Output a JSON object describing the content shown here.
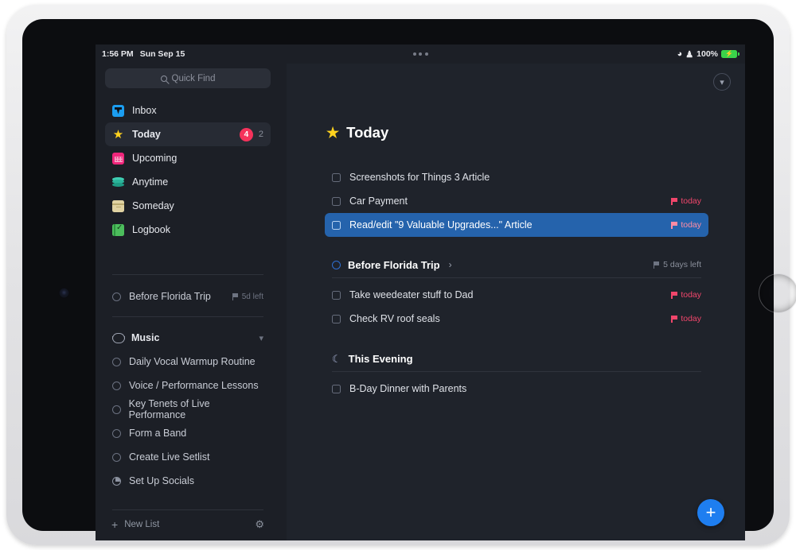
{
  "status_bar": {
    "time": "1:56 PM",
    "date": "Sun Sep 15",
    "battery_percent": "100%",
    "wifi_icon": "wifi-icon",
    "headphones_icon": "headphones-icon",
    "battery_icon": "battery-charging-icon",
    "menu_icon": "more-options-icon"
  },
  "sidebar": {
    "search": {
      "placeholder": "Quick Find",
      "icon": "search-icon"
    },
    "nav": [
      {
        "label": "Inbox",
        "icon": "inbox-icon",
        "badge": "",
        "count": "",
        "active": false
      },
      {
        "label": "Today",
        "icon": "star-icon",
        "badge": "4",
        "count": "2",
        "active": true
      },
      {
        "label": "Upcoming",
        "icon": "calendar-icon",
        "badge": "",
        "count": "",
        "active": false
      },
      {
        "label": "Anytime",
        "icon": "layers-icon",
        "badge": "",
        "count": "",
        "active": false
      },
      {
        "label": "Someday",
        "icon": "box-icon",
        "badge": "",
        "count": "",
        "active": false
      },
      {
        "label": "Logbook",
        "icon": "logbook-icon",
        "badge": "",
        "count": "",
        "active": false
      }
    ],
    "project": {
      "label": "Before Florida Trip",
      "meta": "5d left",
      "icon": "project-circle-icon",
      "meta_icon": "flag-icon"
    },
    "area": {
      "label": "Music",
      "icon": "area-icon",
      "chevron": "chevron-down-icon"
    },
    "area_projects": [
      {
        "label": "Daily Vocal Warmup Routine",
        "icon": "project-circle-icon"
      },
      {
        "label": "Voice / Performance Lessons",
        "icon": "project-circle-icon"
      },
      {
        "label": "Key Tenets of Live Performance",
        "icon": "project-circle-icon"
      },
      {
        "label": "Form a Band",
        "icon": "project-circle-icon"
      },
      {
        "label": "Create Live Setlist",
        "icon": "project-circle-icon"
      },
      {
        "label": "Set Up Socials",
        "icon": "project-progress-icon"
      }
    ],
    "footer": {
      "new_list_label": "New List",
      "plus_icon": "plus-icon",
      "settings_icon": "gear-icon"
    }
  },
  "main": {
    "collapse_icon": "chevron-down-circle-icon",
    "title": "Today",
    "title_icon": "star-icon",
    "todos": [
      {
        "text": "Screenshots for Things 3 Article",
        "when": "",
        "selected": false
      },
      {
        "text": "Car Payment",
        "when": "today",
        "selected": false
      },
      {
        "text": "Read/edit \"9 Valuable Upgrades...\" Article",
        "when": "today",
        "selected": true
      }
    ],
    "groups": [
      {
        "title": "Before Florida Trip",
        "icon": "project-circle-icon",
        "chevron": "chevron-right-icon",
        "meta": "5 days left",
        "meta_icon": "flag-icon",
        "items": [
          {
            "text": "Take weedeater stuff to Dad",
            "when": "today"
          },
          {
            "text": "Check RV roof seals",
            "when": "today"
          }
        ]
      },
      {
        "title": "This Evening",
        "icon": "moon-icon",
        "chevron": "",
        "meta": "",
        "meta_icon": "",
        "items": [
          {
            "text": "B-Day Dinner with Parents",
            "when": ""
          }
        ]
      }
    ],
    "fab_label": "+",
    "fab_icon": "add-todo-icon"
  },
  "colors": {
    "accent_blue": "#1e7ef0",
    "selection_blue": "#2563ac",
    "badge_red": "#f5325b",
    "due_red": "#f0466b",
    "star_yellow": "#ffd21e",
    "screen_bg": "#1f232b",
    "sidebar_bg": "#1c1f26"
  }
}
